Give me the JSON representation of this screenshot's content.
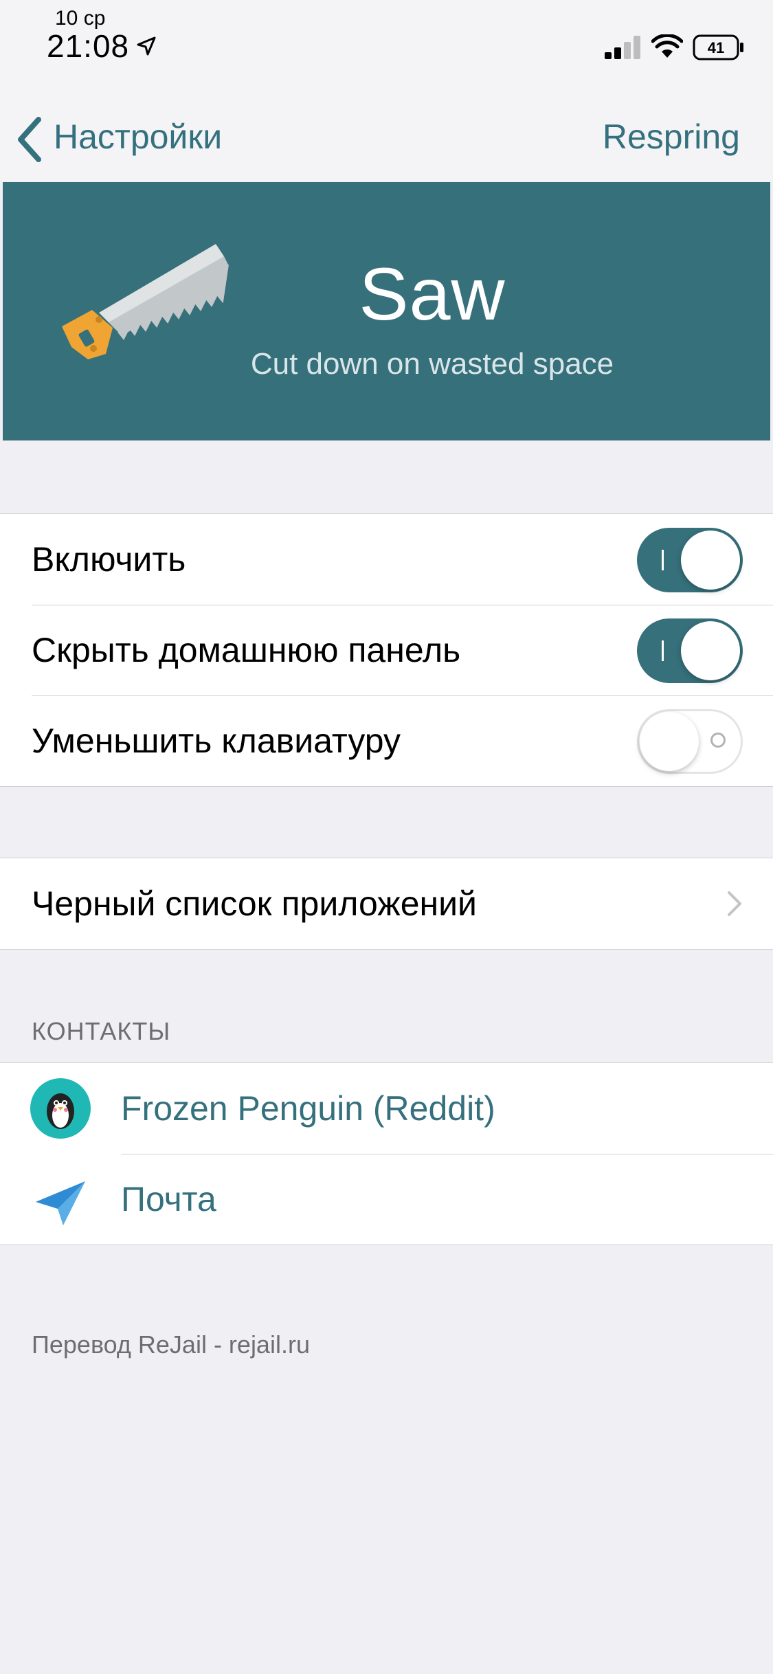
{
  "status_bar": {
    "date": "10 ср",
    "time": "21:08",
    "battery": "41",
    "icons": [
      "location-arrow-icon",
      "cellular-signal-icon",
      "wifi-icon",
      "battery-icon"
    ]
  },
  "nav": {
    "back_label": "Настройки",
    "action_label": "Respring",
    "accent_color": "#34707d"
  },
  "banner": {
    "title": "Saw",
    "subtitle": "Cut down on wasted space",
    "background_color": "#36707b",
    "icon": "saw-icon"
  },
  "toggles": [
    {
      "label": "Включить",
      "on": true
    },
    {
      "label": "Скрыть домашнюю панель",
      "on": true
    },
    {
      "label": "Уменьшить клавиатуру",
      "on": false
    }
  ],
  "blacklist": {
    "label": "Черный список приложений",
    "icon": "chevron-right-icon"
  },
  "contacts": {
    "header": "КОНТАКТЫ",
    "items": [
      {
        "label": "Frozen Penguin (Reddit)",
        "icon": "penguin-icon"
      },
      {
        "label": "Почта",
        "icon": "paper-plane-icon"
      }
    ]
  },
  "footer": {
    "text": "Перевод ReJail - rejail.ru"
  }
}
